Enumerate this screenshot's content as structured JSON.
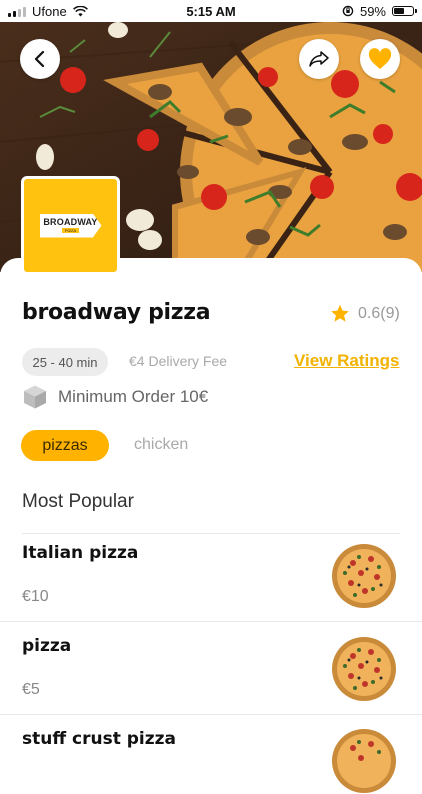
{
  "status_bar": {
    "carrier": "Ufone",
    "time": "5:15 AM",
    "battery": "59%",
    "battery_level": 0.59
  },
  "hero": {
    "icons": [
      "back-arrow-icon",
      "share-icon",
      "heart-icon"
    ],
    "accent": "#ffb300"
  },
  "restaurant": {
    "logo_text": "BROADWAY",
    "logo_sub": "PIZZA",
    "name": "broadway pizza",
    "rating": "0.6(9)",
    "delivery_time": "25 - 40 min",
    "delivery_fee": "€4 Delivery Fee",
    "view_ratings": "View Ratings",
    "minimum_order": "Minimum Order 10€"
  },
  "categories": {
    "active": "pizzas",
    "inactive": "chicken"
  },
  "menu": {
    "section_title": "Most Popular",
    "items": [
      {
        "name": "Italian pizza",
        "price": "€10"
      },
      {
        "name": "pizza",
        "price": "€5"
      },
      {
        "name": "stuff crust pizza",
        "price": ""
      }
    ]
  },
  "colors": {
    "accent": "#ffb300",
    "brand_yellow": "#ffc20e",
    "link": "#f2b200"
  }
}
